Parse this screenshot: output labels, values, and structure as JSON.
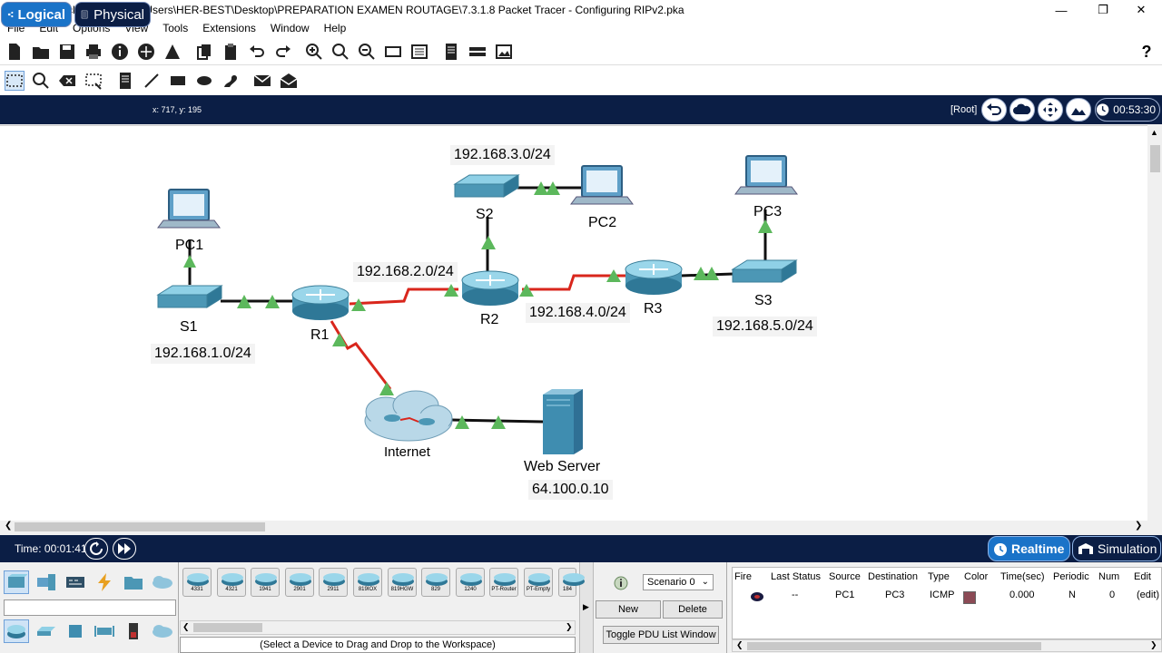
{
  "window": {
    "title": "Cisco Packet Tracer - C:\\Users\\HER-BEST\\Desktop\\PREPARATION EXAMEN ROUTAGE\\7.3.1.8 Packet Tracer - Configuring RIPv2.pka"
  },
  "menu": [
    "File",
    "Edit",
    "Options",
    "View",
    "Tools",
    "Extensions",
    "Window",
    "Help"
  ],
  "modebar": {
    "logical": "Logical",
    "physical": "Physical",
    "coords": "x: 717, y: 195",
    "root": "[Root]",
    "clock": "00:53:30"
  },
  "topology": {
    "devices": {
      "pc1": "PC1",
      "pc2": "PC2",
      "pc3": "PC3",
      "s1": "S1",
      "s2": "S2",
      "s3": "S3",
      "r1": "R1",
      "r2": "R2",
      "r3": "R3",
      "internet": "Internet",
      "webserver": "Web Server"
    },
    "networks": {
      "net1": "192.168.1.0/24",
      "net2": "192.168.2.0/24",
      "net3": "192.168.3.0/24",
      "net4": "192.168.4.0/24",
      "net5": "192.168.5.0/24",
      "server_ip": "64.100.0.10"
    }
  },
  "timebar": {
    "time": "Time: 00:01:41",
    "realtime": "Realtime",
    "simulation": "Simulation"
  },
  "device_panel": {
    "models": [
      "4331",
      "4321",
      "1941",
      "2901",
      "2911",
      "819IOX",
      "819HGW",
      "829",
      "1240",
      "PT-Router",
      "PT-Empty",
      "184"
    ],
    "status": "(Select a Device to Drag and Drop to the Workspace)"
  },
  "scenario": {
    "selected": "Scenario 0",
    "new_label": "New",
    "delete_label": "Delete",
    "toggle_label": "Toggle PDU List Window"
  },
  "pdu_table": {
    "headers": [
      "Fire",
      "Last Status",
      "Source",
      "Destination",
      "Type",
      "Color",
      "Time(sec)",
      "Periodic",
      "Num",
      "Edit"
    ],
    "row": {
      "last_status": "--",
      "source": "PC1",
      "destination": "PC3",
      "type": "ICMP",
      "time": "0.000",
      "periodic": "N",
      "num": "0",
      "edit": "(edit)"
    },
    "row_color": "#8b4a55"
  },
  "colors": {
    "navbar": "#0b1e45",
    "accent": "#1a73c8",
    "link_up": "#5cb85c",
    "serial": "#d9261c"
  }
}
